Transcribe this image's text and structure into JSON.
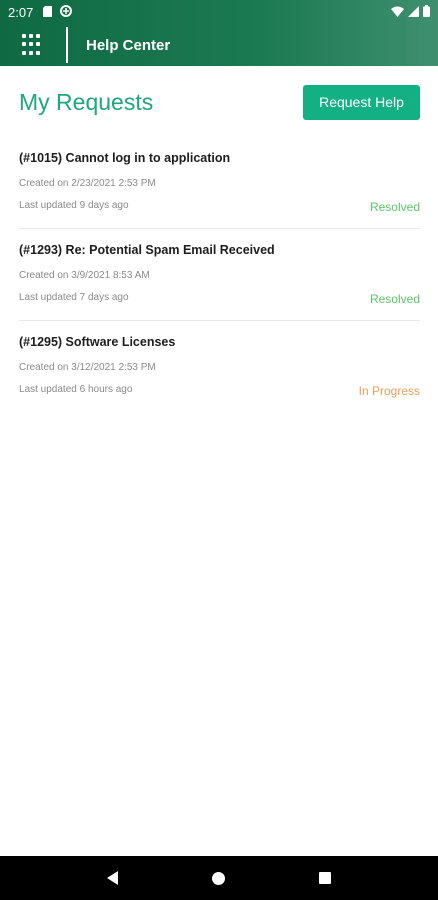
{
  "status_bar": {
    "time": "2:07"
  },
  "appbar": {
    "title": "Help Center"
  },
  "page": {
    "title": "My Requests",
    "request_button": "Request Help"
  },
  "requests": [
    {
      "title": "(#1015) Cannot log in to application",
      "created": "Created on 2/23/2021 2:53 PM",
      "updated": "Last updated 9 days ago",
      "status": "Resolved",
      "status_color": "#5cc46a"
    },
    {
      "title": "(#1293) Re: Potential Spam Email Received",
      "created": "Created on 3/9/2021 8:53 AM",
      "updated": "Last updated 7 days ago",
      "status": "Resolved",
      "status_color": "#5cc46a"
    },
    {
      "title": "(#1295) Software Licenses",
      "created": "Created on 3/12/2021 2:53 PM",
      "updated": "Last updated 6 hours ago",
      "status": "In Progress",
      "status_color": "#e8a05a"
    }
  ],
  "colors": {
    "appbar": "#1c7a52",
    "accent": "#13b083",
    "title": "#1ea77b"
  },
  "icons": {
    "apps": "apps-grid-icon",
    "back": "back-icon",
    "home": "home-icon",
    "recents": "recents-icon"
  }
}
